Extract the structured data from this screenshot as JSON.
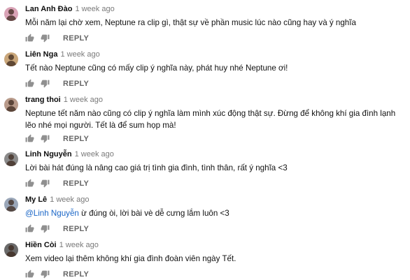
{
  "comments": [
    {
      "author": "Lan Anh Đào",
      "time": "1 week ago",
      "text": "Mỗi năm lại chờ xem, Neptune ra clip gì, thật sự về phần music lúc nào cũng hay và ý nghĩa",
      "reply_label": "REPLY",
      "avatar_color": "#d9a3b6"
    },
    {
      "author": "Liên Nga",
      "time": "1 week ago",
      "text": "Tết nào Neptune cũng có mấy clip ý nghĩa này, phát huy nhé Neptune ơi!",
      "reply_label": "REPLY",
      "avatar_color": "#c9a67a"
    },
    {
      "author": "trang thoi",
      "time": "1 week ago",
      "text": "Neptune tết năm nào cũng có clip ý nghĩa làm mình xúc động thật sự. Đừng để không khí gia đình lạnh lẽo nhé mọi người. Tết là để sum họp mà!",
      "reply_label": "REPLY",
      "avatar_color": "#b89a8a"
    },
    {
      "author": "Linh Nguyễn",
      "time": "1 week ago",
      "text": "Lời bài hát đúng là nâng cao giá trị tình gia đình, tình thân, rất ý nghĩa <3",
      "reply_label": "REPLY",
      "avatar_color": "#8a8a8a"
    },
    {
      "author": "My Lê",
      "time": "1 week ago",
      "mention": "@Linh Nguyễn",
      "text": " ừ đúng òi, lời bài vè dễ cưng lắm luôn <3",
      "reply_label": "REPLY",
      "avatar_color": "#9aa6b8"
    },
    {
      "author": "Hiền Còi",
      "time": "1 week ago",
      "text": "Xem video lại thêm không khí gia đình đoàn viên ngày Tết.",
      "reply_label": "REPLY",
      "avatar_color": "#6a6a6a"
    }
  ],
  "colors": {
    "mention": "#1a66c7",
    "icon": "#909090",
    "reply": "#666666"
  },
  "icons": {
    "like": "thumbs-up-icon",
    "dislike": "thumbs-down-icon"
  }
}
